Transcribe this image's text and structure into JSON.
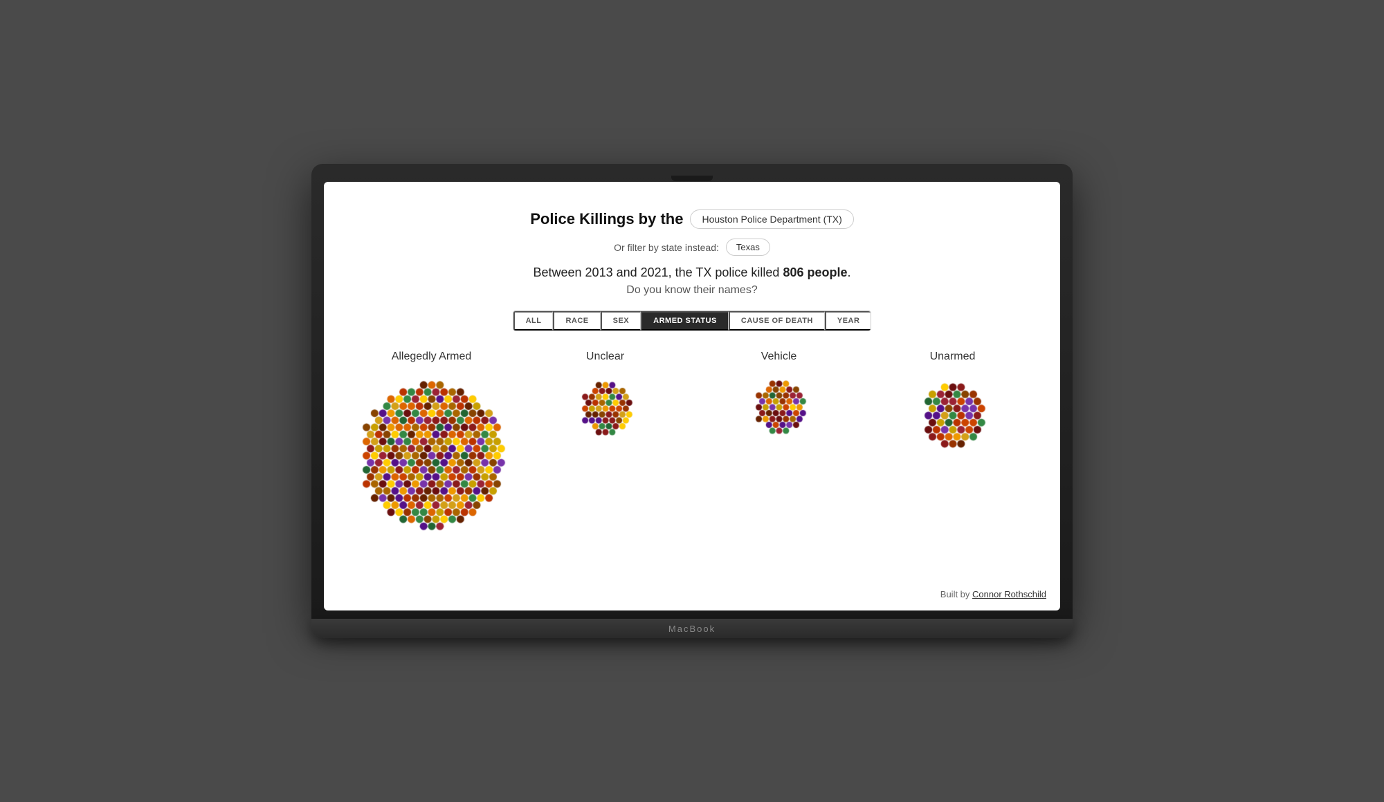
{
  "title": {
    "prefix": "Police Killings by the",
    "department": "Houston Police Department (TX)",
    "state_label": "Or filter by state instead:",
    "state": "Texas",
    "stat": "Between 2013 and 2021, the TX police killed",
    "count": "806 people",
    "subtitle": "Do you know their names?"
  },
  "filters": {
    "tabs": [
      "ALL",
      "RACE",
      "SEX",
      "ARMED STATUS",
      "CAUSE OF DEATH",
      "YEAR"
    ],
    "active": "ARMED STATUS"
  },
  "categories": [
    {
      "label": "Allegedly Armed",
      "count": 580,
      "radius": 110
    },
    {
      "label": "Unclear",
      "count": 68,
      "radius": 42
    },
    {
      "label": "Vehicle",
      "count": 60,
      "radius": 40
    },
    {
      "label": "Unarmed",
      "count": 98,
      "radius": 52
    }
  ],
  "colors": [
    "#c8a000",
    "#d4a017",
    "#8b1a1a",
    "#6b0f0f",
    "#9b2335",
    "#cc4400",
    "#884400",
    "#aa6600",
    "#662200",
    "#338844",
    "#226633",
    "#7733aa",
    "#551188",
    "#dd6600",
    "#bb3300",
    "#ffcc00",
    "#ee9900",
    "#993300"
  ],
  "footer": {
    "text": "Built by",
    "author": "Connor Rothschild",
    "link": "#"
  },
  "laptop_brand": "MacBook"
}
